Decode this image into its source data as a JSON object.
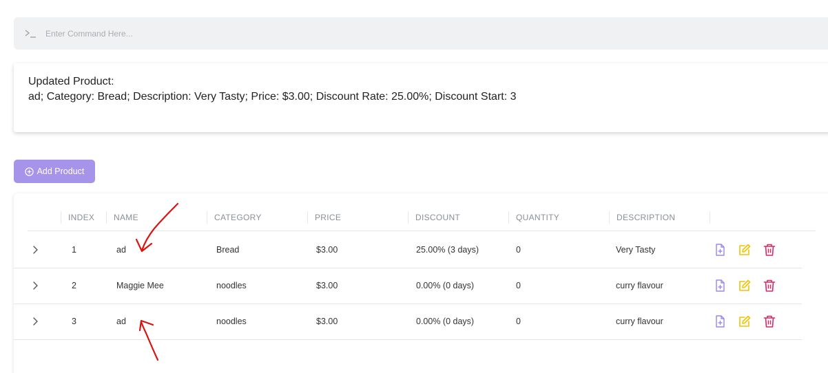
{
  "command_bar": {
    "placeholder": "Enter Command Here..."
  },
  "output": {
    "line1": "Updated Product:",
    "line2": "ad; Category: Bread; Description: Very Tasty; Price: $3.00; Discount Rate: 25.00%; Discount Start: 3"
  },
  "add_button": {
    "label": "Add Product"
  },
  "table": {
    "headers": [
      "INDEX",
      "NAME",
      "CATEGORY",
      "PRICE",
      "DISCOUNT",
      "QUANTITY",
      "DESCRIPTION"
    ],
    "rows": [
      {
        "index": "1",
        "name": "ad",
        "category": "Bread",
        "price": "$3.00",
        "discount": "25.00% (3 days)",
        "quantity": "0",
        "description": "Very Tasty"
      },
      {
        "index": "2",
        "name": "Maggie Mee",
        "category": "noodles",
        "price": "$3.00",
        "discount": "0.00% (0 days)",
        "quantity": "0",
        "description": "curry flavour"
      },
      {
        "index": "3",
        "name": "ad",
        "category": "noodles",
        "price": "$3.00",
        "discount": "0.00% (0 days)",
        "quantity": "0",
        "description": "curry flavour"
      }
    ]
  },
  "colors": {
    "accent": "#a693ea",
    "view_icon": "#9b86e6",
    "edit_icon": "#f2c200",
    "delete_icon": "#e0245e",
    "annotation": "#d9140e"
  },
  "icons": {
    "prompt": "terminal-prompt-icon",
    "add": "plus-circle-icon",
    "expand": "chevron-right-icon",
    "view": "file-plus-icon",
    "edit": "edit-pencil-icon",
    "delete": "trash-icon"
  }
}
